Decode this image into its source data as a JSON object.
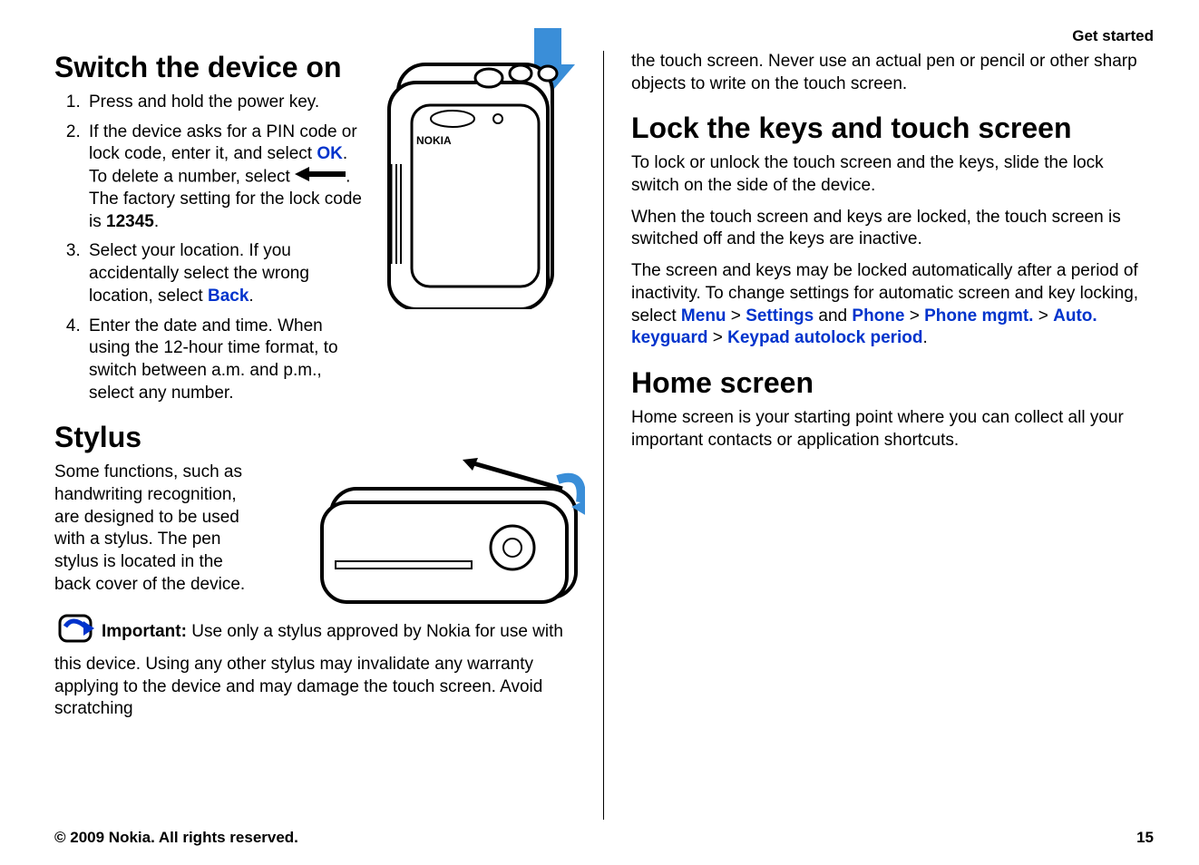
{
  "header": {
    "section": "Get started"
  },
  "left": {
    "h1_switch": "Switch the device on",
    "li1": "Press and hold the power key.",
    "li2_a": "If the device asks for a PIN code or lock code, enter it, and select ",
    "li2_ok": "OK",
    "li2_b": ". To delete a number, select ",
    "li2_c": ". The factory setting for the lock code is ",
    "li2_code": "12345",
    "li2_d": ".",
    "li3_a": "Select your location. If you accidentally select the wrong location, select ",
    "li3_back": "Back",
    "li3_b": ".",
    "li4": "Enter the date and time. When using the 12-hour time format, to switch between a.m. and p.m., select any number.",
    "h1_stylus": "Stylus",
    "stylus_p": "Some functions, such as handwriting recognition, are designed to be used with a stylus. The pen stylus is located in the back cover of the device.",
    "important_label": "Important:",
    "important_a": "  Use only a stylus approved by Nokia for use with this device. Using any other stylus may invalidate any warranty applying to the device and may damage the touch screen. Avoid scratching"
  },
  "right": {
    "cont": "the touch screen. Never use an actual pen or pencil or other sharp objects to write on the touch screen.",
    "h1_lock": "Lock the keys and touch screen",
    "lock_p1": "To lock or unlock the touch screen and the keys, slide the lock switch on the side of the device.",
    "lock_p2": "When the touch screen and keys are locked, the touch screen is switched off and the keys are inactive.",
    "lock_p3_a": "The screen and keys may be locked automatically after a period of inactivity. To change settings for automatic screen and key locking, select ",
    "menu": "Menu",
    "gt1": " > ",
    "settings": "Settings",
    "and": " and ",
    "phone": "Phone",
    "gt2": " > ",
    "phone_mgmt": "Phone mgmt.",
    "gt3": " > ",
    "auto_keyguard": "Auto. keyguard",
    "gt4": " > ",
    "keypad_autolock": "Keypad autolock period",
    "period_dot": ".",
    "h1_home": "Home screen",
    "home_p": "Home screen is your starting point where you can collect all your important contacts or application shortcuts."
  },
  "footer": {
    "copyright": "© 2009 Nokia. All rights reserved.",
    "page": "15"
  }
}
